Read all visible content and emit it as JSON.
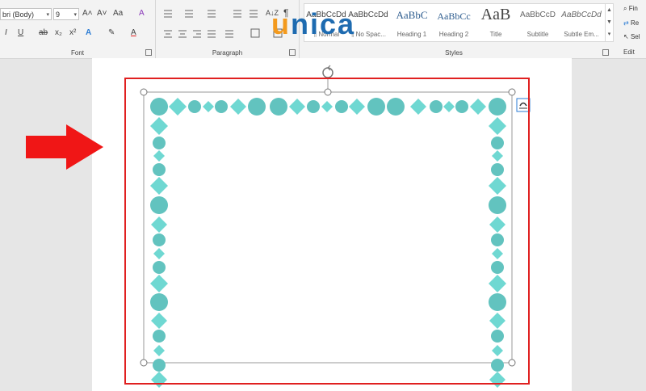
{
  "ribbon": {
    "font": {
      "label": "Font",
      "font_name": "bri (Body)",
      "font_size": "9",
      "grow_font": "A˄",
      "shrink_font": "A˅",
      "change_case": "Aa",
      "italic": "I",
      "underline": "U",
      "strikethrough": "ab",
      "subscript": "x₂",
      "superscript": "x²",
      "text_effects": "A",
      "highlight": "✎",
      "font_color": "A"
    },
    "paragraph": {
      "label": "Paragraph",
      "show_marks": "¶",
      "sort": "A↓Z"
    },
    "styles": {
      "label": "Styles",
      "items": [
        {
          "preview": "AaBbCcDd",
          "name": "¶ Normal"
        },
        {
          "preview": "AaBbCcDd",
          "name": "¶ No Spac..."
        },
        {
          "preview": "AaBbC",
          "name": "Heading 1"
        },
        {
          "preview": "AaBbCc",
          "name": "Heading 2"
        },
        {
          "preview": "AaB",
          "name": "Title"
        },
        {
          "preview": "AaBbCcD",
          "name": "Subtitle"
        },
        {
          "preview": "AaBbCcDd",
          "name": "Subtle Em..."
        }
      ]
    },
    "editing": {
      "label": "Edit",
      "find": "Fin",
      "replace": "Re",
      "select": "Sel"
    }
  },
  "watermark": {
    "u": "u",
    "rest": "nica"
  },
  "colors": {
    "border_fill": "#6fd8d2",
    "border_circle": "#62c3bf",
    "highlight_box": "#e02020",
    "arrow": "#f01616",
    "selection": "#9a9a9a"
  }
}
